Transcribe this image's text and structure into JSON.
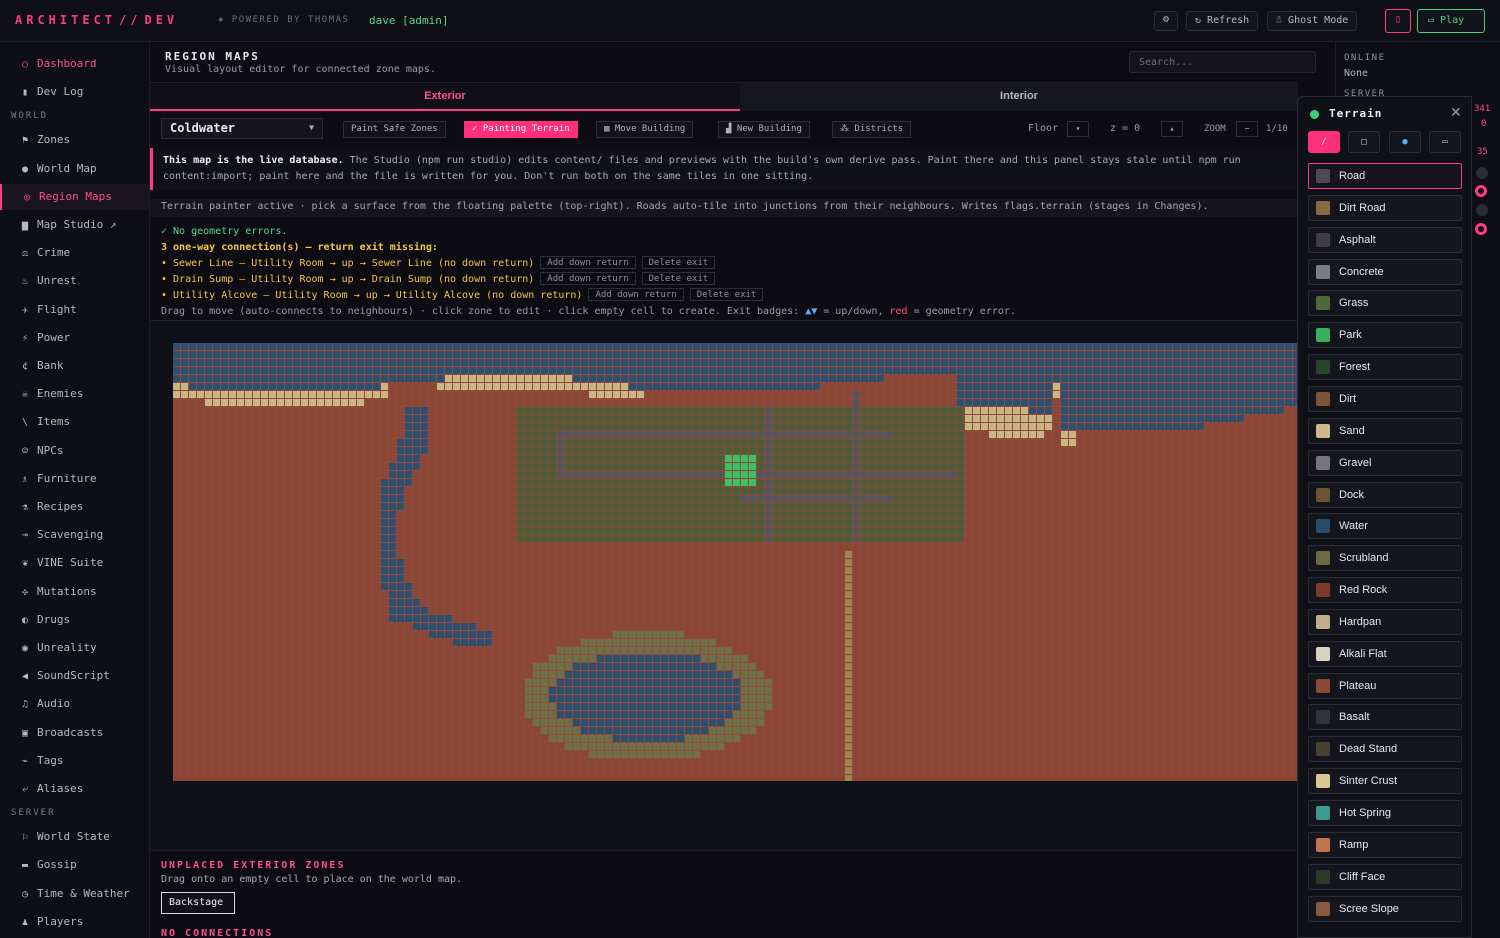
{
  "topbar": {
    "brand": "ARCHITECT",
    "brand_sep": "//",
    "brand_dev": "DEV",
    "powered": "POWERED BY THOMAS",
    "user": "dave [admin]",
    "refresh": "Refresh",
    "ghost": "Ghost Mode",
    "play": "Play"
  },
  "sidebar": {
    "top_items": [
      {
        "label": "Dashboard",
        "icon": "circle-icon"
      },
      {
        "label": "Dev Log",
        "icon": "notebook-icon"
      }
    ],
    "world_heading": "WORLD",
    "world_items": [
      {
        "label": "Zones",
        "icon": "map-icon"
      },
      {
        "label": "World Map",
        "icon": "globe-icon"
      },
      {
        "label": "Region Maps",
        "icon": "target-icon"
      },
      {
        "label": "Map Studio ↗",
        "icon": "studio-icon"
      },
      {
        "label": "Crime",
        "icon": "crime-icon"
      },
      {
        "label": "Unrest",
        "icon": "fire-icon"
      },
      {
        "label": "Flight",
        "icon": "plane-icon"
      },
      {
        "label": "Power",
        "icon": "bolt-icon"
      },
      {
        "label": "Bank",
        "icon": "currency-icon"
      },
      {
        "label": "Enemies",
        "icon": "skull-icon"
      },
      {
        "label": "Items",
        "icon": "sword-icon"
      },
      {
        "label": "NPCs",
        "icon": "face-icon"
      },
      {
        "label": "Furniture",
        "icon": "chair-icon"
      },
      {
        "label": "Recipes",
        "icon": "flask-icon"
      },
      {
        "label": "Scavenging",
        "icon": "wrench-icon"
      },
      {
        "label": "VINE Suite",
        "icon": "vine-icon"
      },
      {
        "label": "Mutations",
        "icon": "dna-icon"
      },
      {
        "label": "Drugs",
        "icon": "pill-icon"
      },
      {
        "label": "Unreality",
        "icon": "eye-icon"
      },
      {
        "label": "SoundScript",
        "icon": "speaker-icon"
      },
      {
        "label": "Audio",
        "icon": "music-icon"
      },
      {
        "label": "Broadcasts",
        "icon": "radio-icon"
      },
      {
        "label": "Tags",
        "icon": "tag-icon"
      },
      {
        "label": "Aliases",
        "icon": "alias-icon"
      }
    ],
    "server_heading": "SERVER",
    "server_items": [
      {
        "label": "World State",
        "icon": "flag-icon"
      },
      {
        "label": "Gossip",
        "icon": "chat-icon"
      },
      {
        "label": "Time & Weather",
        "icon": "clock-icon"
      },
      {
        "label": "Players",
        "icon": "players-icon"
      }
    ]
  },
  "header": {
    "title": "REGION MAPS",
    "subtitle": "Visual layout editor for connected zone maps.",
    "search_placeholder": "Search..."
  },
  "tabs": {
    "exterior": "Exterior",
    "interior": "Interior"
  },
  "toolbar": {
    "region": "Coldwater",
    "tools": [
      "Paint Safe Zones",
      "✓ Painting Terrain",
      "Move Building",
      "New Building",
      "Districts"
    ],
    "floor_label": "Floor",
    "z_label": "z = 0",
    "zoom_label": "ZOOM",
    "zoom_value": "1/10"
  },
  "notice": {
    "bold": "This map is the live database.",
    "text": "The Studio (npm run studio) edits content/ files and previews with the build's own derive pass. Paint there and this panel stays stale until npm run content:import; paint here and the file is written for you. Don't run both on the same tiles in one sitting."
  },
  "hint": "Terrain painter active · pick a surface from the floating palette (top-right). Roads auto-tile into junctions from their neighbours. Writes flags.terrain (stages in Changes).",
  "geometry": {
    "ok": "✓ No geometry errors.",
    "warn": "3 one-way connection(s) — return exit missing:",
    "errors": [
      {
        "text": "• Sewer Line — Utility Room → up → Sewer Line (no down return)",
        "add": "Add down return",
        "del": "Delete exit"
      },
      {
        "text": "• Drain Sump — Utility Room → up → Drain Sump (no down return)",
        "add": "Add down return",
        "del": "Delete exit"
      },
      {
        "text": "• Utility Alcove — Utility Room → up → Utility Alcove (no down return)",
        "add": "Add down return",
        "del": "Delete exit"
      }
    ],
    "drag_a": "Drag to move (auto-connects to neighbours) · click zone to edit · click empty cell to create. Exit badges: ",
    "drag_badge": "▲▼",
    "drag_b": " = up/down, ",
    "drag_red": "red",
    "drag_c": " = geometry error."
  },
  "unplaced": {
    "title": "UNPLACED EXTERIOR ZONES",
    "sub": "Drag onto an empty cell to place on the world map.",
    "chip": "Backstage",
    "noconn": "NO CONNECTIONS"
  },
  "rside": {
    "online_label": "ONLINE",
    "online_value": "None",
    "server_label": "SERVER",
    "edge_a": "341",
    "edge_b": "0",
    "edge_c": "35"
  },
  "terrain": {
    "title": "Terrain",
    "tools": [
      "/",
      "□",
      "●",
      "▭"
    ],
    "items": [
      {
        "label": "Road",
        "color": "#4a4a52"
      },
      {
        "label": "Dirt Road",
        "color": "#8a6a45"
      },
      {
        "label": "Asphalt",
        "color": "#3e3e44"
      },
      {
        "label": "Concrete",
        "color": "#7d7d84"
      },
      {
        "label": "Grass",
        "color": "#4f6a3a"
      },
      {
        "label": "Park",
        "color": "#36b05a"
      },
      {
        "label": "Forest",
        "color": "#27472c"
      },
      {
        "label": "Dirt",
        "color": "#7b5536"
      },
      {
        "label": "Sand",
        "color": "#cdb98c"
      },
      {
        "label": "Gravel",
        "color": "#75757b"
      },
      {
        "label": "Dock",
        "color": "#6b5434"
      },
      {
        "label": "Water",
        "color": "#2a4a6e"
      },
      {
        "label": "Scrubland",
        "color": "#6f6a42"
      },
      {
        "label": "Red Rock",
        "color": "#7c3a2c"
      },
      {
        "label": "Hardpan",
        "color": "#bfae8a"
      },
      {
        "label": "Alkali Flat",
        "color": "#d8d2c2"
      },
      {
        "label": "Plateau",
        "color": "#8a4c33"
      },
      {
        "label": "Basalt",
        "color": "#33333b"
      },
      {
        "label": "Dead Stand",
        "color": "#4a3f33"
      },
      {
        "label": "Sinter Crust",
        "color": "#d9c896"
      },
      {
        "label": "Hot Spring",
        "color": "#3a9a8e"
      },
      {
        "label": "Ramp",
        "color": "#c0764a"
      },
      {
        "label": "Cliff Face",
        "color": "#2d3a2a"
      },
      {
        "label": "Scree Slope",
        "color": "#8a5a3e"
      }
    ]
  }
}
